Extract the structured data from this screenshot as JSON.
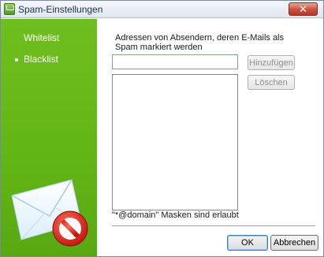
{
  "window": {
    "title": "Spam-Einstellungen",
    "close_label": "✕",
    "help_label": "?"
  },
  "sidebar": {
    "items": [
      {
        "label": "Whitelist",
        "selected": false
      },
      {
        "label": "Blacklist",
        "selected": true
      }
    ]
  },
  "main": {
    "prompt": "Adressen von Absendern, deren E-Mails als Spam markiert werden",
    "address_input_value": "",
    "add_button": "Hinzufügen",
    "delete_button": "Löschen",
    "mask_note": "\"*@domain\" Masken sind erlaubt",
    "list_items": []
  },
  "footer": {
    "ok_button": "OK",
    "cancel_button": "Abbrechen"
  },
  "colors": {
    "sidebar_green": "#62b516",
    "title_text": "#1b2f4b",
    "close_red": "#c9503c"
  }
}
